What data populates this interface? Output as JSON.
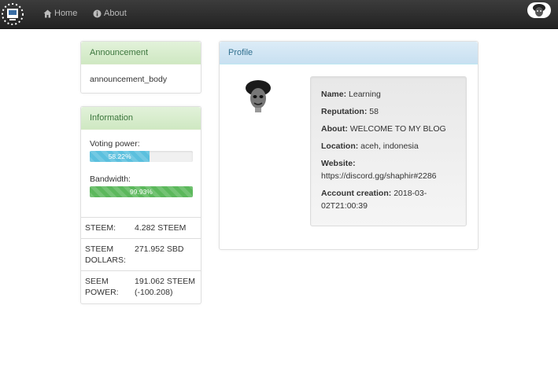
{
  "nav": {
    "home_label": "Home",
    "about_label": "About"
  },
  "announcement": {
    "title": "Announcement",
    "body": "announcement_body"
  },
  "information": {
    "title": "Information",
    "voting_power_label": "Voting power:",
    "voting_power_value": "58.22%",
    "voting_power_fraction": 0.5822,
    "bandwidth_label": "Bandwidth:",
    "bandwidth_value": "99.93%",
    "bandwidth_fraction": 0.9993,
    "rows": [
      {
        "key": "STEEM:",
        "value": "4.282 STEEM"
      },
      {
        "key": "STEEM DOLLARS:",
        "value": "271.952 SBD"
      },
      {
        "key": "SEEM POWER:",
        "value": "191.062 STEEM (-100.208)"
      }
    ]
  },
  "profile": {
    "title": "Profile",
    "name_label": "Name:",
    "name_value": "Learning",
    "reputation_label": "Reputation:",
    "reputation_value": "58",
    "about_label": "About:",
    "about_value": "WELCOME TO MY BLOG",
    "location_label": "Location:",
    "location_value": "aceh, indonesia",
    "website_label": "Website:",
    "website_value": "https://discord.gg/shaphir#2286",
    "creation_label": "Account creation:",
    "creation_value": "2018-03-02T21:00:39"
  },
  "colors": {
    "voting_bar": "#5bc0de",
    "bandwidth_bar": "#5cb85c"
  }
}
